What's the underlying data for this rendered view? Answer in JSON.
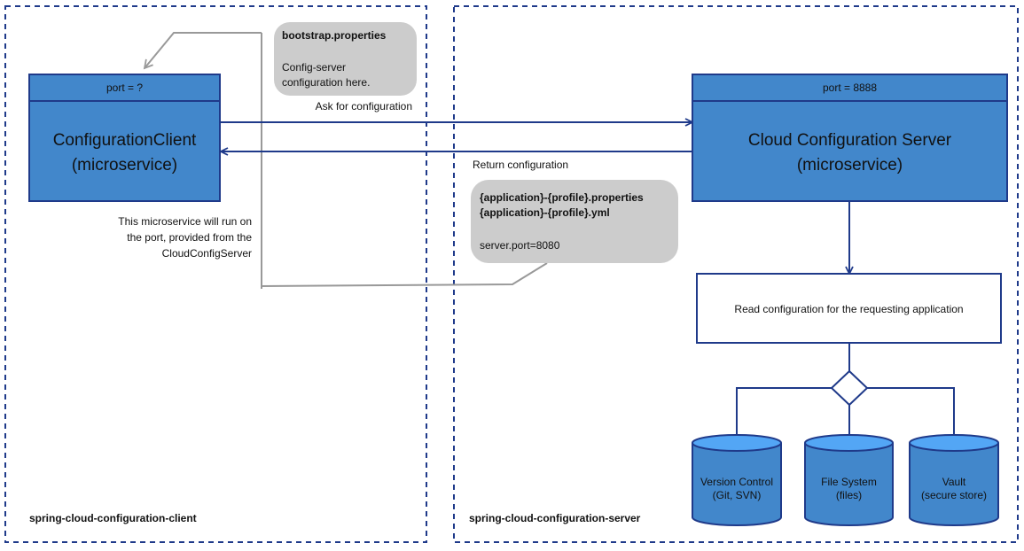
{
  "colors": {
    "box_fill": "#4287CB",
    "box_border": "#1F3A8A",
    "cylinder_top": "#53A6F5",
    "bubble": "#CCCCCC",
    "connector_gray": "#999999"
  },
  "client": {
    "container_label": "spring-cloud-configuration-client",
    "port_label": "port = ?",
    "title_line1": "ConfigurationClient",
    "title_line2": "(microservice)",
    "note_lines": [
      "This microservice will run on",
      "the port, provided from the",
      "CloudConfigServer"
    ]
  },
  "bootstrap_bubble": {
    "title": "bootstrap.properties",
    "lines": [
      "Config-server",
      "configuration here."
    ]
  },
  "arrows": {
    "ask": "Ask for configuration",
    "return": "Return configuration"
  },
  "config_bubble": {
    "title_lines": [
      "{application}-{profile}.properties",
      "{application}-{profile}.yml"
    ],
    "body": "server.port=8080"
  },
  "server": {
    "container_label": "spring-cloud-configuration-server",
    "port_label": "port = 8888",
    "title_line1": "Cloud Configuration Server",
    "title_line2": "(microservice)",
    "read_box": "Read configuration for the requesting application",
    "stores": [
      {
        "line1": "Version Control",
        "line2": "(Git, SVN)"
      },
      {
        "line1": "File System",
        "line2": "(files)"
      },
      {
        "line1": "Vault",
        "line2": "(secure store)"
      }
    ]
  }
}
